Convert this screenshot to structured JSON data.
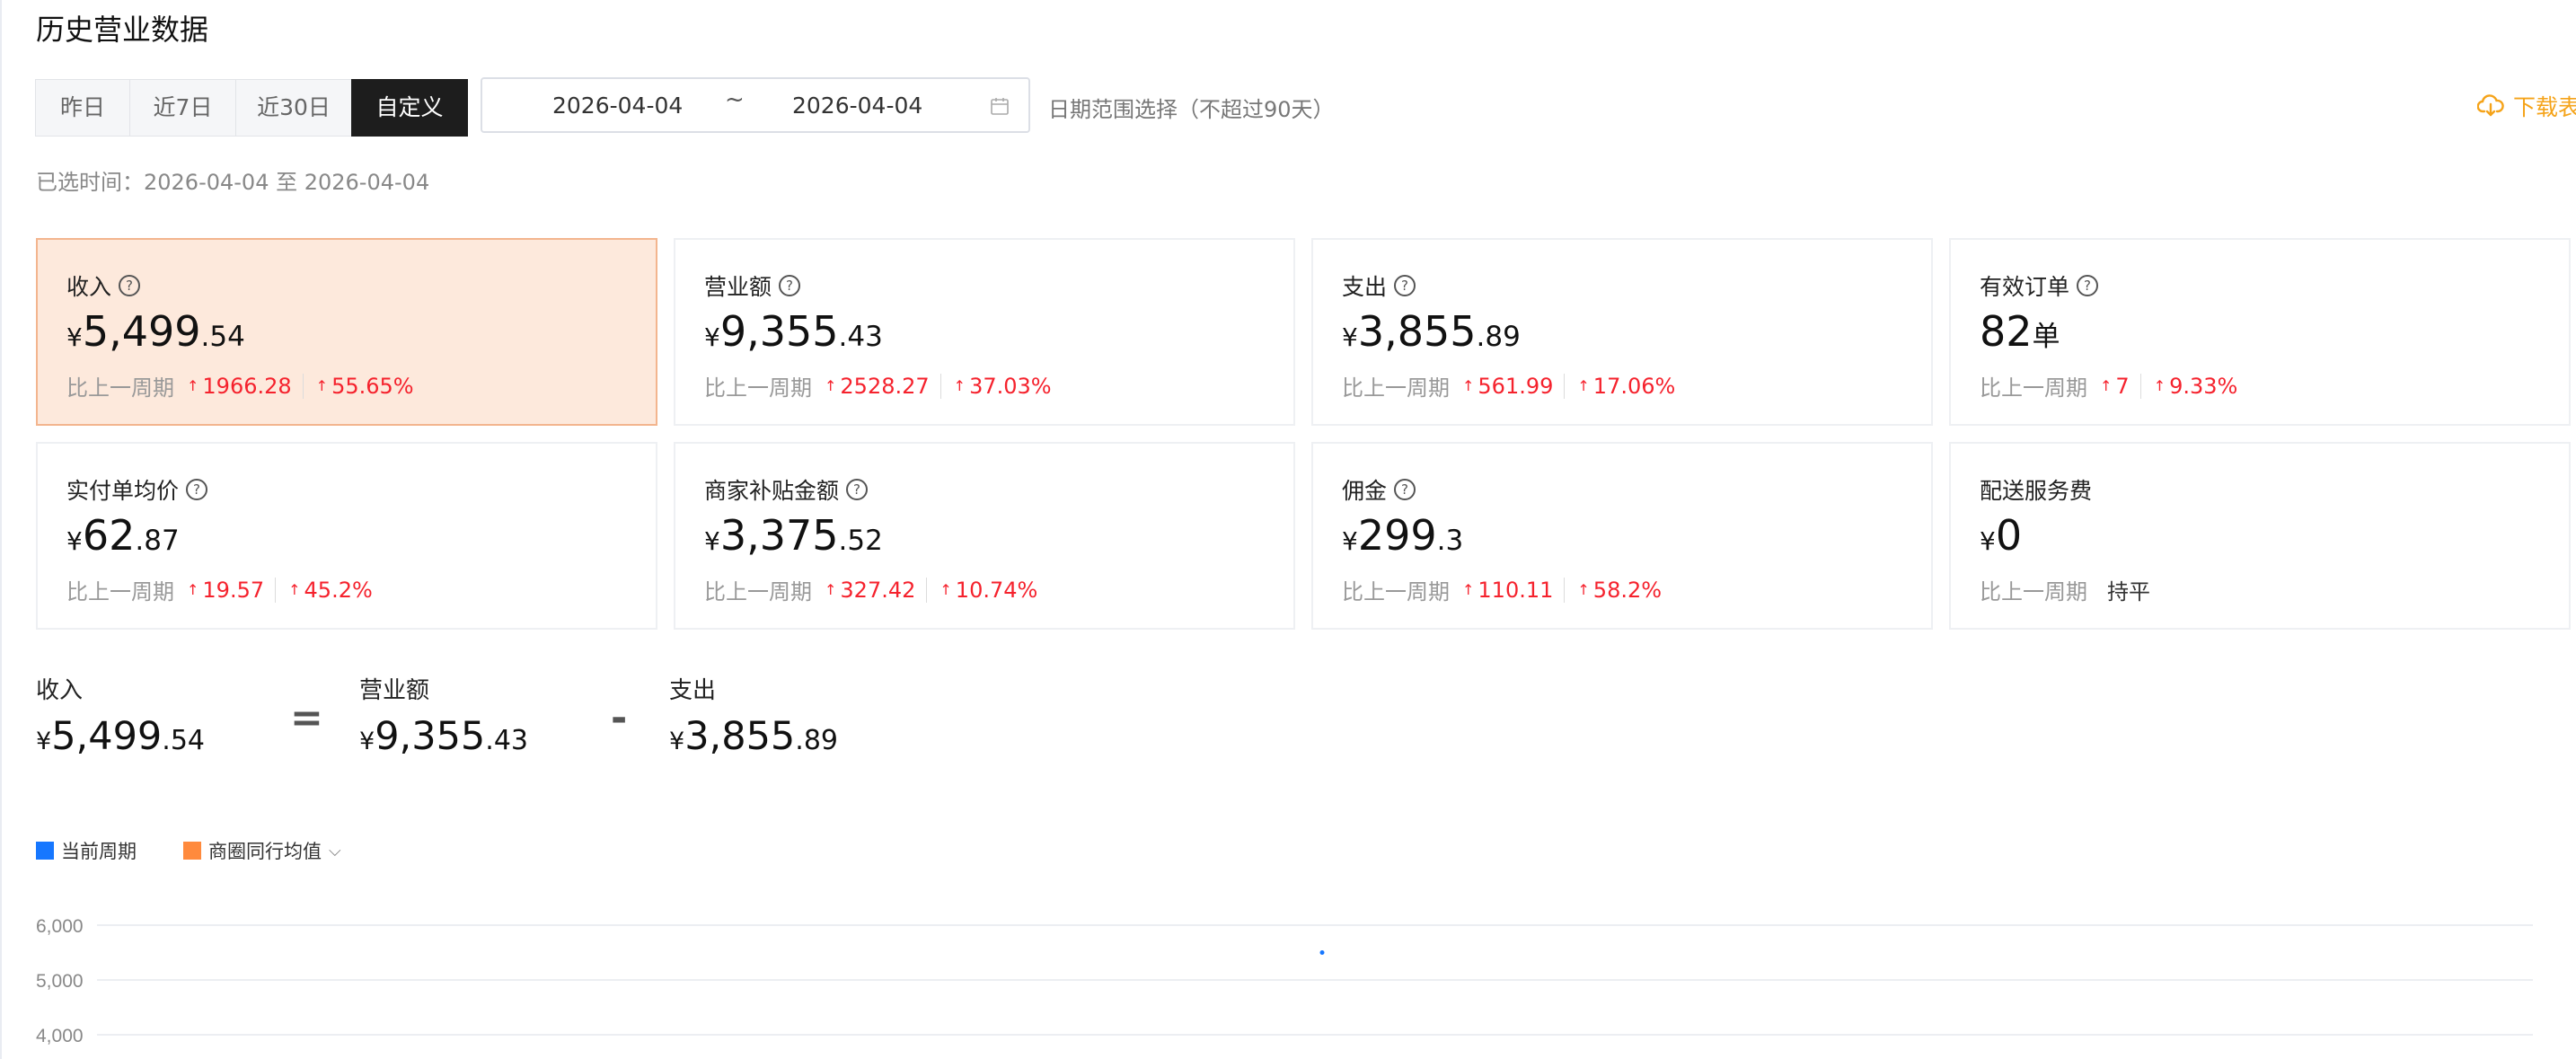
{
  "title": "历史营业数据",
  "segments": [
    {
      "label": "昨日",
      "active": false
    },
    {
      "label": "近7日",
      "active": false
    },
    {
      "label": "近30日",
      "active": false
    },
    {
      "label": "自定义",
      "active": true
    }
  ],
  "date_range": {
    "start": "2026-04-04",
    "separator": "~",
    "end": "2026-04-04",
    "icon": "calendar-icon"
  },
  "range_hint": "日期范围选择（不超过90天）",
  "download_label": "下载表格",
  "selected_time": "已选时间：2026-04-04 至 2026-04-04",
  "cards": [
    {
      "label": "收入",
      "currency": "¥",
      "int": "5,499",
      "dec": ".54",
      "compare_label": "比上一周期",
      "change_abs": "1966.28",
      "change_pct": "55.65%",
      "help": true,
      "highlight": true
    },
    {
      "label": "营业额",
      "currency": "¥",
      "int": "9,355",
      "dec": ".43",
      "compare_label": "比上一周期",
      "change_abs": "2528.27",
      "change_pct": "37.03%",
      "help": true
    },
    {
      "label": "支出",
      "currency": "¥",
      "int": "3,855",
      "dec": ".89",
      "compare_label": "比上一周期",
      "change_abs": "561.99",
      "change_pct": "17.06%",
      "help": true
    },
    {
      "label": "有效订单",
      "currency": "",
      "int": "82",
      "dec": "单",
      "compare_label": "比上一周期",
      "change_abs": "7",
      "change_pct": "9.33%",
      "help": true
    },
    {
      "label": "实付单均价",
      "currency": "¥",
      "int": "62",
      "dec": ".87",
      "compare_label": "比上一周期",
      "change_abs": "19.57",
      "change_pct": "45.2%",
      "help": true
    },
    {
      "label": "商家补贴金额",
      "currency": "¥",
      "int": "3,375",
      "dec": ".52",
      "compare_label": "比上一周期",
      "change_abs": "327.42",
      "change_pct": "10.74%",
      "help": true
    },
    {
      "label": "佣金",
      "currency": "¥",
      "int": "299",
      "dec": ".3",
      "compare_label": "比上一周期",
      "change_abs": "110.11",
      "change_pct": "58.2%",
      "help": true
    },
    {
      "label": "配送服务费",
      "currency": "¥",
      "int": "0",
      "dec": "",
      "compare_label": "比上一周期",
      "flat_label": "持平",
      "help": false
    }
  ],
  "formula": {
    "income": {
      "label": "收入",
      "currency": "¥",
      "int": "5,499",
      "dec": ".54"
    },
    "eq": "=",
    "revenue": {
      "label": "营业额",
      "currency": "¥",
      "int": "9,355",
      "dec": ".43"
    },
    "minus": "-",
    "expense": {
      "label": "支出",
      "currency": "¥",
      "int": "3,855",
      "dec": ".89"
    }
  },
  "legend": [
    {
      "label": "当前周期",
      "color": "#1677ff"
    },
    {
      "label": "商圈同行均值",
      "color": "#ff8a3d",
      "dropdown": true
    }
  ],
  "chart_data": {
    "type": "line",
    "ytick_labels": [
      "6,000",
      "5,000",
      "4,000"
    ],
    "ylim": [
      4000,
      6000
    ],
    "grid": true,
    "series": [
      {
        "color": "#1677ff",
        "points": [
          {
            "y": 5499.54
          }
        ]
      }
    ]
  }
}
